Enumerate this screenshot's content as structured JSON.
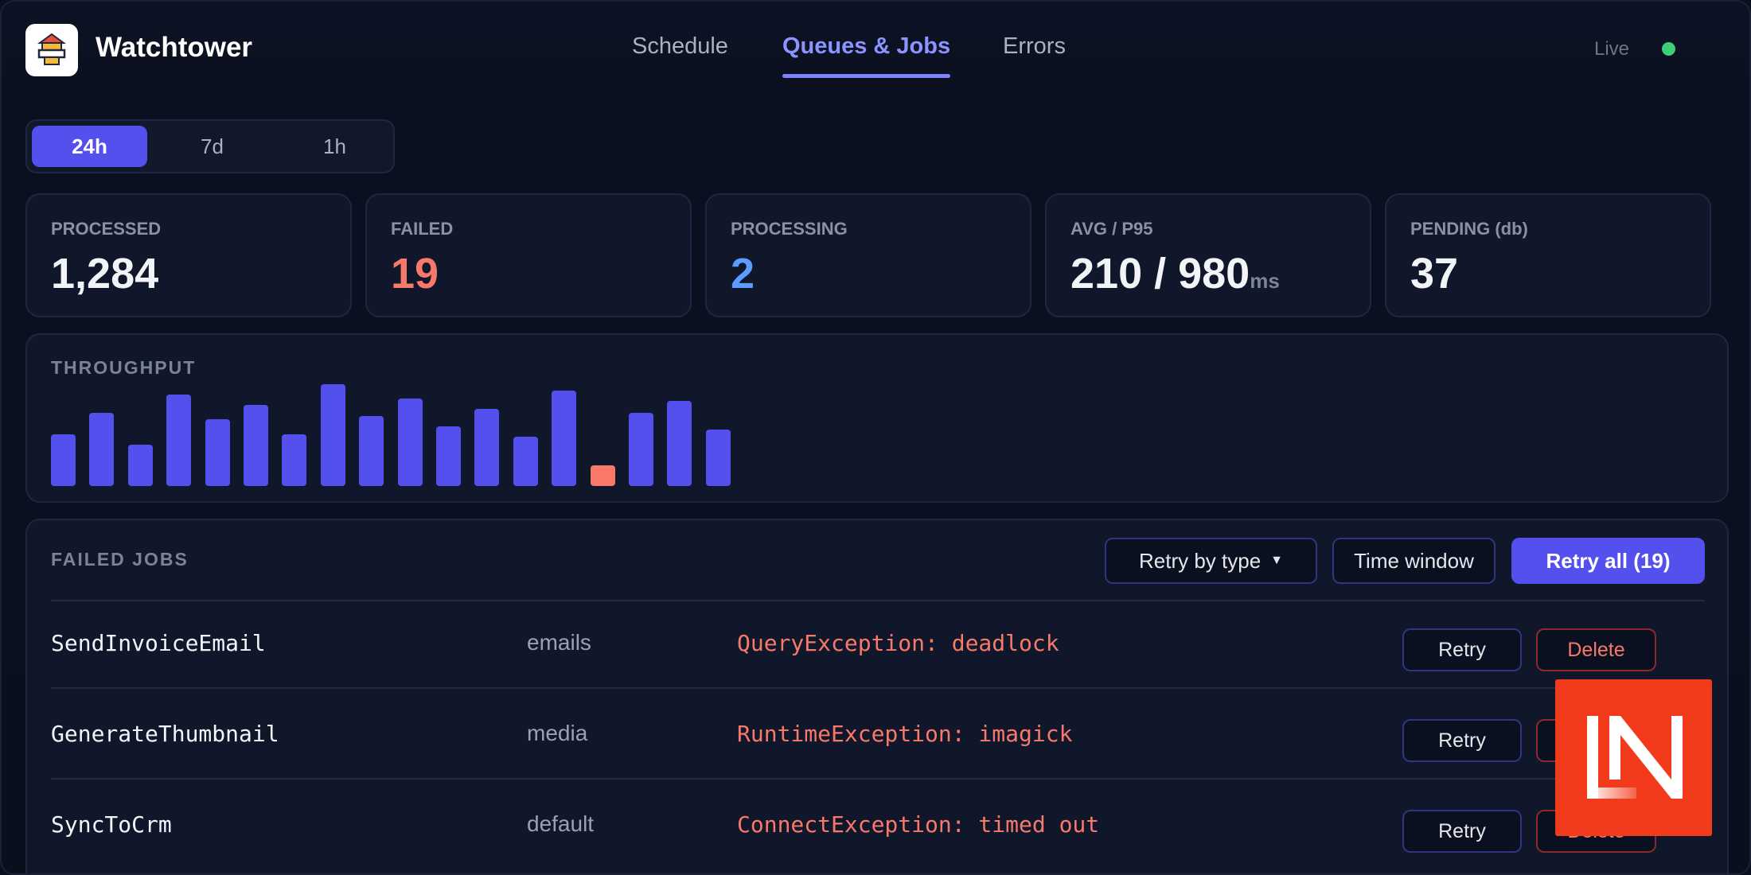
{
  "app": {
    "title": "Watchtower"
  },
  "nav": {
    "items": [
      {
        "label": "Schedule"
      },
      {
        "label": "Queues & Jobs"
      },
      {
        "label": "Errors"
      }
    ],
    "active": "Queues & Jobs"
  },
  "status": {
    "label": "Live",
    "dot_color": "#3fce78"
  },
  "time_range": {
    "options": [
      "24h",
      "7d",
      "1h"
    ],
    "selected": "24h"
  },
  "stats": [
    {
      "label": "PROCESSED",
      "value": "1,284"
    },
    {
      "label": "FAILED",
      "value": "19",
      "color": "#f8786a"
    },
    {
      "label": "PROCESSING",
      "value": "2",
      "color": "#5b9cff"
    },
    {
      "label": "AVG / P95",
      "value": "210 / 980",
      "unit": "ms"
    },
    {
      "label": "PENDING (db)",
      "value": "37"
    }
  ],
  "throughput": {
    "title": "THROUGHPUT",
    "bars": [
      {
        "value": 55
      },
      {
        "value": 78
      },
      {
        "value": 44
      },
      {
        "value": 97
      },
      {
        "value": 71
      },
      {
        "value": 86
      },
      {
        "value": 55
      },
      {
        "value": 108
      },
      {
        "value": 74
      },
      {
        "value": 93
      },
      {
        "value": 63
      },
      {
        "value": 82
      },
      {
        "value": 52
      },
      {
        "value": 101
      },
      {
        "value": 22,
        "failed": true
      },
      {
        "value": 78
      },
      {
        "value": 90
      },
      {
        "value": 60
      }
    ],
    "colors": {
      "normal": "#5450ee",
      "failed": "#f8786a"
    }
  },
  "failed_jobs": {
    "title": "FAILED JOBS",
    "actions": {
      "retry_by_type": "Retry by type",
      "time_window": "Time window",
      "retry_all": "Retry all (19)"
    },
    "rows": [
      {
        "name": "SendInvoiceEmail",
        "queue": "emails",
        "error": "QueryException: deadlock",
        "retry": "Retry",
        "delete": "Delete"
      },
      {
        "name": "GenerateThumbnail",
        "queue": "media",
        "error": "RuntimeException: imagick",
        "retry": "Retry",
        "delete": "Delete"
      },
      {
        "name": "SyncToCrm",
        "queue": "default",
        "error": "ConnectException: timed out",
        "retry": "Retry",
        "delete": "Delete"
      }
    ]
  },
  "colors": {
    "accent": "#5450ee",
    "danger": "#f8786a",
    "info": "#5b9cff",
    "badge": "#f23b1c"
  },
  "watermark": {
    "text": "LN"
  }
}
